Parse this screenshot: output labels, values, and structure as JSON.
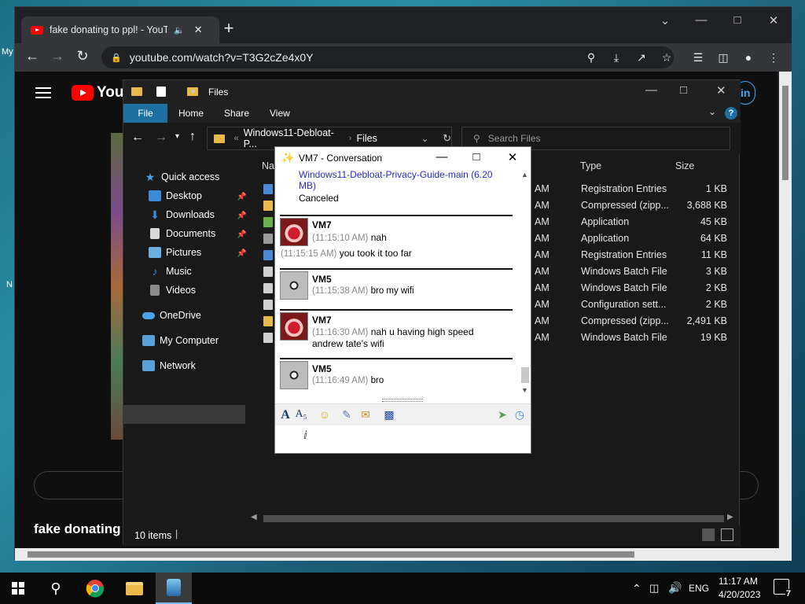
{
  "desktop": {
    "fragments": [
      "My",
      "N"
    ]
  },
  "browser": {
    "tab_title": "fake donating to ppl! - YouTu",
    "new_tab": "+",
    "url": "youtube.com/watch?v=T3G2cZe4x0Y",
    "window_controls": [
      "minimize-icon",
      "maximize-icon",
      "close-icon"
    ]
  },
  "youtube": {
    "logo_text": "YouTube",
    "signin": "in",
    "video_title": "fake donating"
  },
  "explorer": {
    "title": "Files",
    "ribbon_tabs": [
      "File",
      "Home",
      "Share",
      "View"
    ],
    "address": {
      "parent": "Windows11-Debloat-P...",
      "current": "Files"
    },
    "search_placeholder": "Search Files",
    "nav": {
      "quick_access": "Quick access",
      "desktop": "Desktop",
      "downloads": "Downloads",
      "documents": "Documents",
      "pictures": "Pictures",
      "music": "Music",
      "videos": "Videos",
      "onedrive": "OneDrive",
      "my_computer": "My Computer",
      "network": "Network"
    },
    "columns": {
      "name": "Na",
      "type": "Type",
      "size": "Size"
    },
    "rows": [
      {
        "time": "AM",
        "type": "Registration Entries",
        "size": "1 KB"
      },
      {
        "time": "AM",
        "type": "Compressed (zipp...",
        "size": "3,688 KB"
      },
      {
        "time": "AM",
        "type": "Application",
        "size": "45 KB"
      },
      {
        "time": "AM",
        "type": "Application",
        "size": "64 KB"
      },
      {
        "time": "AM",
        "type": "Registration Entries",
        "size": "11 KB"
      },
      {
        "time": "AM",
        "type": "Windows Batch File",
        "size": "3 KB"
      },
      {
        "time": "AM",
        "type": "Windows Batch File",
        "size": "2 KB"
      },
      {
        "time": "AM",
        "type": "Configuration sett...",
        "size": "2 KB"
      },
      {
        "time": "AM",
        "type": "Compressed (zipp...",
        "size": "2,491 KB"
      },
      {
        "time": "AM",
        "type": "Windows Batch File",
        "size": "19 KB"
      }
    ],
    "status": "10 items"
  },
  "conversation": {
    "title": "VM7 - Conversation",
    "transfer_file": "Windows11-Debloat-Privacy-Guide-main (6.20 MB)",
    "transfer_file_line1": "Windows11-Debloat-Privacy-Guide-main (6.20",
    "transfer_file_line2": "MB)",
    "transfer_status": "Canceled",
    "messages": [
      {
        "sender": "VM7",
        "time": "(11:15:10 AM)",
        "text": "nah",
        "extra_time": "(11:15:15 AM)",
        "extra_text": "you took it too far"
      },
      {
        "sender": "VM5",
        "time": "(11:15:38 AM)",
        "text": "bro my wifi"
      },
      {
        "sender": "VM7",
        "time": "(11:16:30 AM)",
        "text": "nah u having high speed",
        "text2": "andrew tate's wifi"
      },
      {
        "sender": "VM5",
        "time": "(11:16:49 AM)",
        "text": "bro"
      }
    ]
  },
  "taskbar": {
    "language": "ENG",
    "time": "11:17 AM",
    "date": "4/20/2023",
    "notifications": "7"
  }
}
